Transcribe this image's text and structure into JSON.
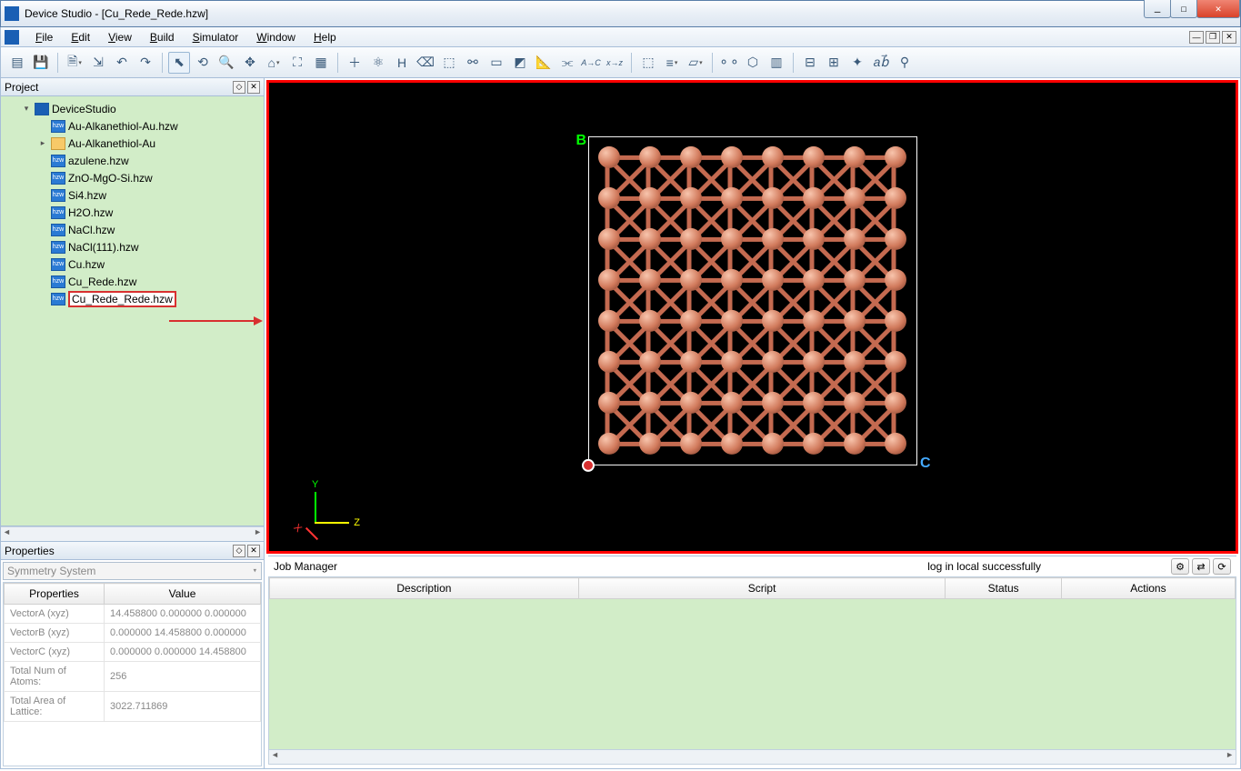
{
  "window": {
    "title": "Device Studio - [Cu_Rede_Rede.hzw]"
  },
  "menu": {
    "file": "File",
    "edit": "Edit",
    "view": "View",
    "build": "Build",
    "simulator": "Simulator",
    "window": "Window",
    "help": "Help"
  },
  "panels": {
    "project_title": "Project",
    "properties_title": "Properties",
    "properties_combo": "Symmetry System",
    "jobman_title": "Job Manager",
    "jobman_status": "log in local successfully"
  },
  "tree": {
    "root": "DeviceStudio",
    "items": [
      {
        "label": "Au-Alkanethiol-Au.hzw",
        "icon": "hzw"
      },
      {
        "label": "Au-Alkanethiol-Au",
        "icon": "folder",
        "expandable": true
      },
      {
        "label": "azulene.hzw",
        "icon": "hzw"
      },
      {
        "label": "ZnO-MgO-Si.hzw",
        "icon": "hzw"
      },
      {
        "label": "Si4.hzw",
        "icon": "hzw"
      },
      {
        "label": "H2O.hzw",
        "icon": "hzw"
      },
      {
        "label": "NaCl.hzw",
        "icon": "hzw"
      },
      {
        "label": "NaCl(111).hzw",
        "icon": "hzw"
      },
      {
        "label": "Cu.hzw",
        "icon": "hzw"
      },
      {
        "label": "Cu_Rede.hzw",
        "icon": "hzw"
      },
      {
        "label": "Cu_Rede_Rede.hzw",
        "icon": "hzw",
        "selected": true
      }
    ]
  },
  "properties": {
    "headers": {
      "col1": "Properties",
      "col2": "Value"
    },
    "rows": [
      {
        "k": "VectorA (xyz)",
        "v": "14.458800 0.000000 0.000000"
      },
      {
        "k": "VectorB (xyz)",
        "v": "0.000000 14.458800 0.000000"
      },
      {
        "k": "VectorC (xyz)",
        "v": "0.000000 0.000000 14.458800"
      },
      {
        "k": "Total Num of Atoms:",
        "v": "256"
      },
      {
        "k": "Total Area of Lattice:",
        "v": "3022.711869"
      }
    ]
  },
  "jobman": {
    "headers": {
      "desc": "Description",
      "script": "Script",
      "status": "Status",
      "actions": "Actions"
    }
  },
  "viewport": {
    "label_b": "B",
    "label_c": "C"
  }
}
